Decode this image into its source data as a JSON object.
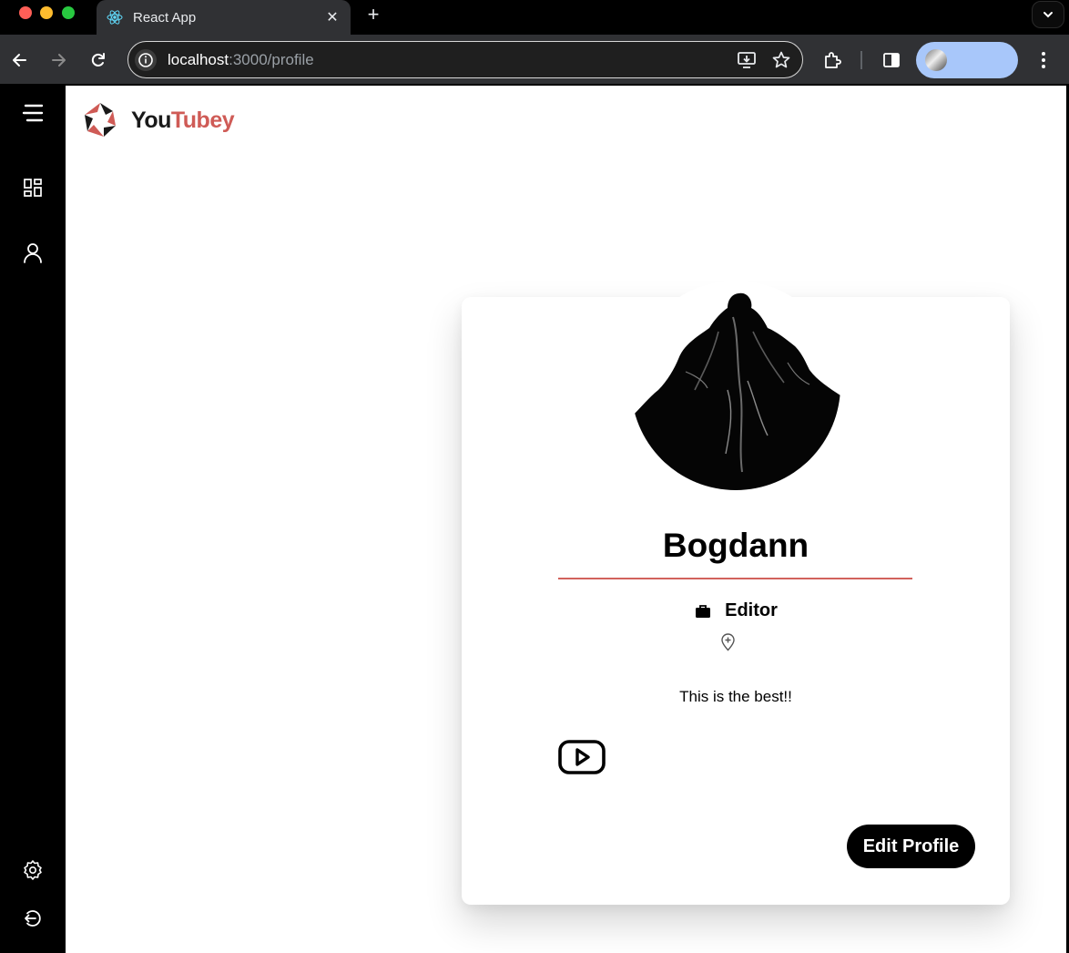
{
  "browser": {
    "tab": {
      "title": "React App",
      "favicon": "react-logo-icon"
    },
    "address": {
      "host": "localhost",
      "path": ":3000/profile"
    },
    "icons": [
      "back-icon",
      "forward-icon",
      "reload-icon",
      "site-info-icon",
      "install-app-icon",
      "bookmark-star-icon",
      "extensions-icon",
      "side-panel-icon",
      "menu-dots-icon"
    ]
  },
  "sidebar": {
    "items": [
      {
        "icon": "hamburger-menu-icon"
      },
      {
        "icon": "dashboard-icon"
      },
      {
        "icon": "user-icon"
      },
      {
        "icon": "gear-icon"
      },
      {
        "icon": "logout-icon"
      }
    ]
  },
  "brand": {
    "part1": "You",
    "part2": "Tubey",
    "accent": "#cf5b56"
  },
  "profile": {
    "name": "Bogdann",
    "role": "Editor",
    "bio": "This is the best!!",
    "edit_label": "Edit Profile"
  }
}
